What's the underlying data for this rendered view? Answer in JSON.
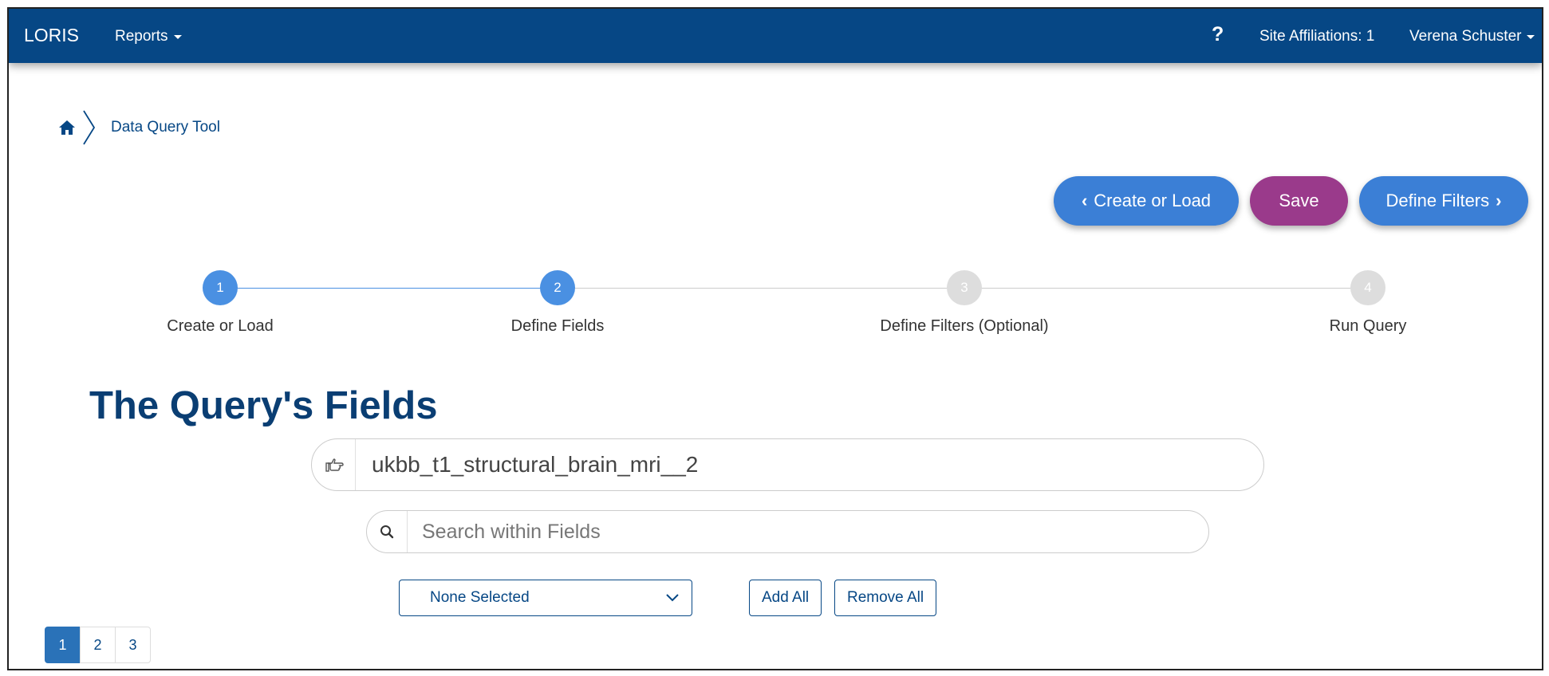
{
  "navbar": {
    "brand": "LORIS",
    "reports_label": "Reports",
    "help_label": "?",
    "site_affiliations": "Site Affiliations: 1",
    "user_name": "Verena Schuster"
  },
  "breadcrumb": {
    "current": "Data Query Tool"
  },
  "actions": {
    "back_label": "Create or Load",
    "save_label": "Save",
    "next_label": "Define Filters"
  },
  "stepper": {
    "steps": [
      {
        "number": "1",
        "label": "Create or Load",
        "state": "complete"
      },
      {
        "number": "2",
        "label": "Define Fields",
        "state": "active"
      },
      {
        "number": "3",
        "label": "Define Filters (Optional)",
        "state": "pending"
      },
      {
        "number": "4",
        "label": "Run Query",
        "state": "pending"
      }
    ],
    "active_color": "#4a90e2",
    "pending_color": "#dddddd"
  },
  "main": {
    "title": "The Query's Fields",
    "field_selector": {
      "value": "ukbb_t1_structural_brain_mri__2",
      "icon": "hand-pointer-icon"
    },
    "search": {
      "placeholder": "Search within Fields",
      "value": ""
    },
    "visit_select": {
      "value": "None Selected"
    },
    "add_all_label": "Add All",
    "remove_all_label": "Remove All"
  },
  "pagination": {
    "pages": [
      "1",
      "2",
      "3"
    ],
    "active": "1"
  },
  "colors": {
    "navbar": "#064785",
    "primary": "#3b7fd6",
    "save": "#9a3a8b"
  }
}
